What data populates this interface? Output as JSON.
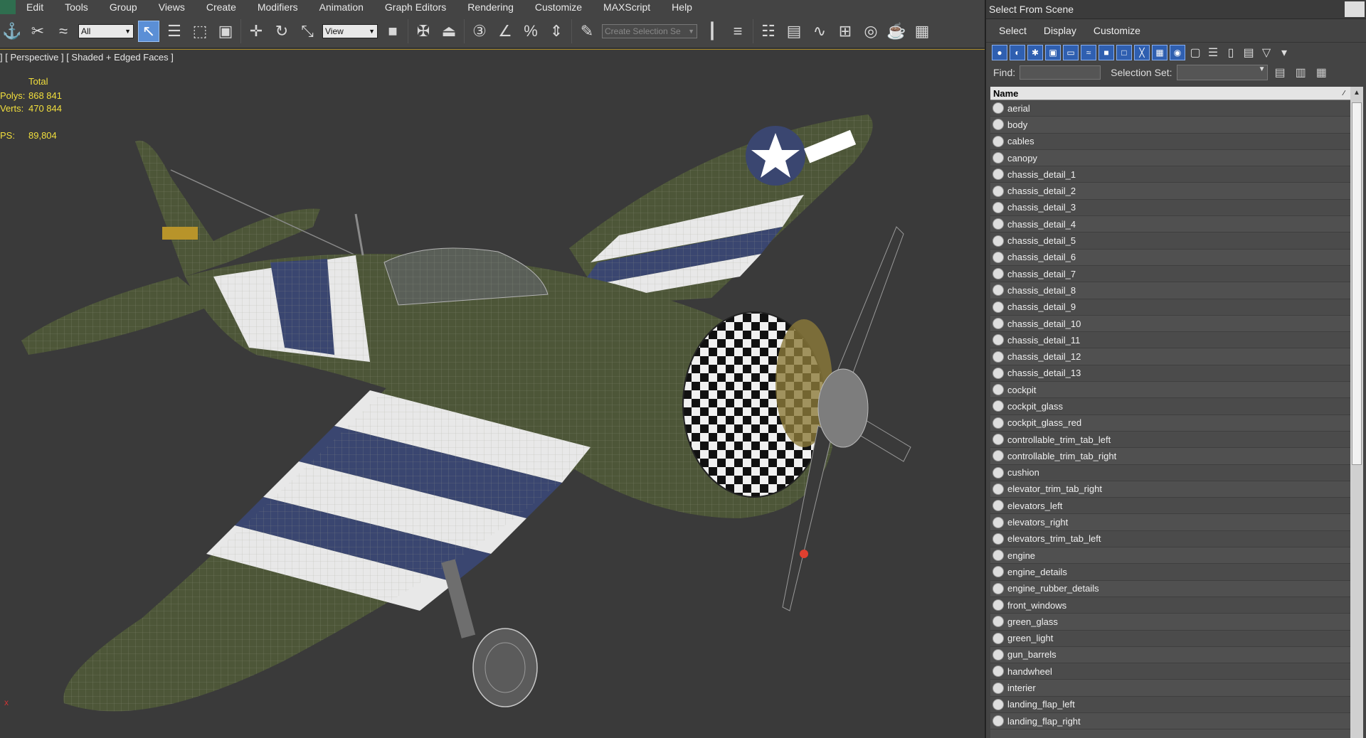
{
  "menubar": {
    "items": [
      "Edit",
      "Tools",
      "Group",
      "Views",
      "Create",
      "Modifiers",
      "Animation",
      "Graph Editors",
      "Rendering",
      "Customize",
      "MAXScript",
      "Help"
    ]
  },
  "toolbar": {
    "filter_combo": "All",
    "refcoord_combo": "View",
    "selection_set_placeholder": "Create Selection Se"
  },
  "viewport": {
    "label": "] [ Perspective ] [ Shaded + Edged Faces ]",
    "stats": {
      "header": "Total",
      "polys_label": "Polys:",
      "polys_value": "868 841",
      "verts_label": "Verts:",
      "verts_value": "470 844",
      "fps_label": "PS:",
      "fps_value": "89,804"
    },
    "axis_label": "x"
  },
  "panel": {
    "title": "Select From Scene",
    "menu": [
      "Select",
      "Display",
      "Customize"
    ],
    "find_label": "Find:",
    "selset_label": "Selection Set:",
    "column_header": "Name",
    "objects": [
      "aerial",
      "body",
      "cables",
      "canopy",
      "chassis_detail_1",
      "chassis_detail_2",
      "chassis_detail_3",
      "chassis_detail_4",
      "chassis_detail_5",
      "chassis_detail_6",
      "chassis_detail_7",
      "chassis_detail_8",
      "chassis_detail_9",
      "chassis_detail_10",
      "chassis_detail_11",
      "chassis_detail_12",
      "chassis_detail_13",
      "cockpit",
      "cockpit_glass",
      "cockpit_glass_red",
      "controllable_trim_tab_left",
      "controllable_trim_tab_right",
      "cushion",
      "elevator_trim_tab_right",
      "elevators_left",
      "elevators_right",
      "elevators_trim_tab_left",
      "engine",
      "engine_details",
      "engine_rubber_details",
      "front_windows",
      "green_glass",
      "green_light",
      "gun_barrels",
      "handwheel",
      "interier",
      "landing_flap_left",
      "landing_flap_right"
    ]
  },
  "colors": {
    "selection_blue": "#5b8fd6",
    "stats_yellow": "#f2df3c",
    "olive_drab": "#4a5436",
    "invasion_blue": "#3a4670"
  }
}
